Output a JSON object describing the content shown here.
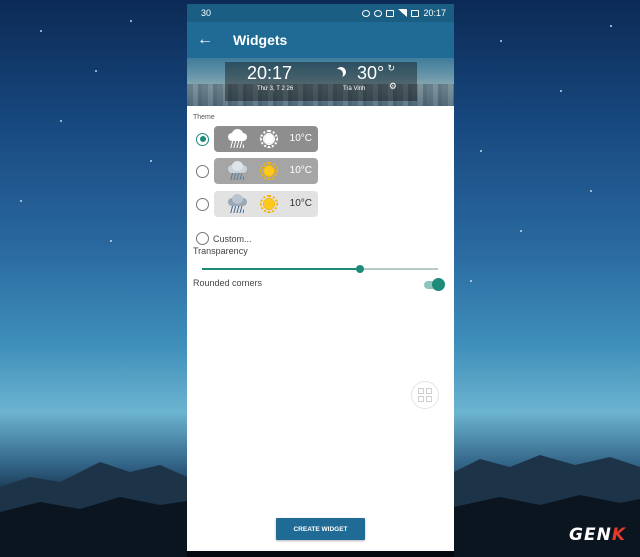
{
  "status_bar": {
    "left_text": "30",
    "time": "20:17"
  },
  "app_bar": {
    "title": "Widgets",
    "back_icon": "arrow-back-icon"
  },
  "preview": {
    "time": "20:17",
    "date": "Thứ 3, T 2 26",
    "temperature": "30°",
    "city": "Trà Vinh",
    "weather_icon": "night-cloud-icon",
    "refresh_icon": "refresh-icon",
    "settings_icon": "gear-icon"
  },
  "theme": {
    "label": "Theme",
    "options": [
      {
        "temp": "10°C",
        "style": "dark",
        "selected": true
      },
      {
        "temp": "10°C",
        "style": "medium",
        "selected": false
      },
      {
        "temp": "10°C",
        "style": "light",
        "selected": false
      }
    ],
    "custom_label": "Custom..."
  },
  "transparency": {
    "label": "Transparency",
    "value": 0.67
  },
  "rounded_corners": {
    "label": "Rounded corners",
    "enabled": true
  },
  "create_button": {
    "label": "CREATE WIDGET"
  },
  "watermark": {
    "text_main": "GEN",
    "text_accent": "K"
  },
  "colors": {
    "primary": "#1f6b96",
    "accent": "#1e8a7a"
  }
}
